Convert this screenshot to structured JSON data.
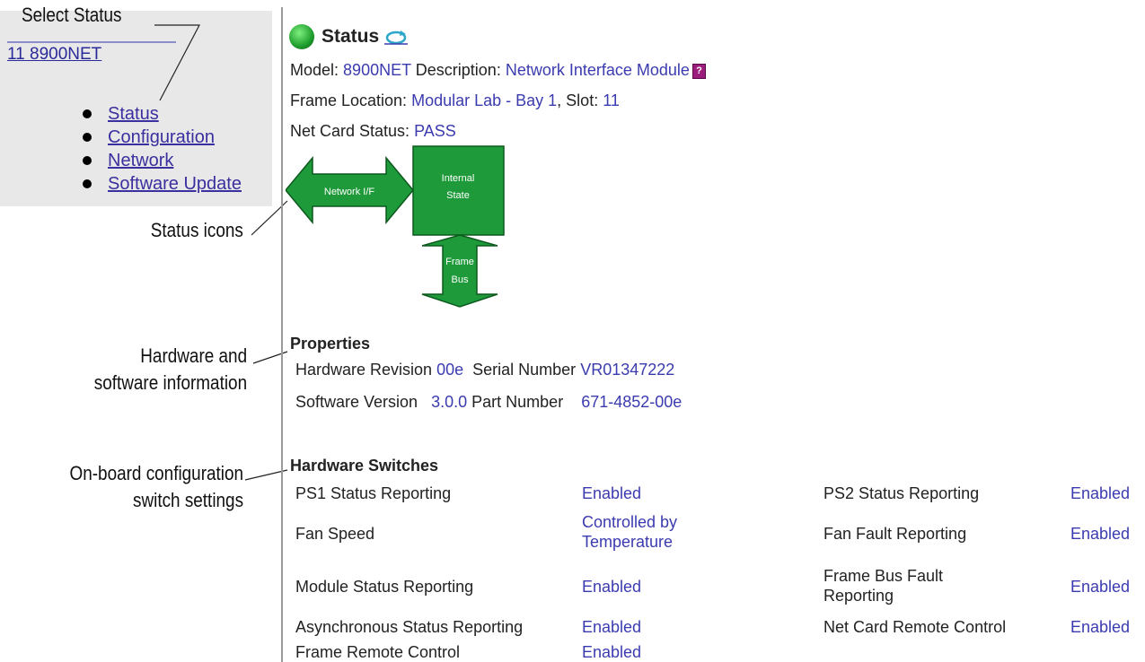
{
  "callouts": {
    "select_status": "Select Status",
    "status_icons": "Status icons",
    "hw_sw_line1": "Hardware and",
    "hw_sw_line2": "software information",
    "onboard_line1": "On-board configuration",
    "onboard_line2": "switch settings"
  },
  "nav": {
    "module_link": "11 8900NET",
    "items": [
      {
        "label": "Status"
      },
      {
        "label": "Configuration"
      },
      {
        "label": "Network"
      },
      {
        "label": "Software Update"
      }
    ]
  },
  "status": {
    "title": "Status",
    "model_label": "Model:",
    "model_value": "8900NET",
    "description_label": "Description:",
    "description_value": "Network Interface Module",
    "help_glyph": "?",
    "frame_location_label": "Frame Location:",
    "frame_location_value": "Modular Lab - Bay 1",
    "slot_label": ", Slot:",
    "slot_value": "11",
    "net_card_label": "Net Card Status:",
    "net_card_value": "PASS"
  },
  "diagram": {
    "network_if": "Network I/F",
    "internal_line1": "Internal",
    "internal_line2": "State",
    "frame_line1": "Frame",
    "frame_line2": "Bus",
    "fill_color": "#1f9a3a"
  },
  "properties": {
    "heading": "Properties",
    "hw_rev_label": "Hardware Revision",
    "hw_rev_value": "00e",
    "serial_label": "Serial Number",
    "serial_value": "VR01347222",
    "sw_ver_label": "Software Version",
    "sw_ver_value": "3.0.0",
    "part_label": "Part Number",
    "part_value": "671-4852-00e"
  },
  "switches": {
    "heading": "Hardware Switches",
    "rows": [
      {
        "l1": "PS1 Status Reporting",
        "v1": "Enabled",
        "l2": "PS2 Status Reporting",
        "v2": "Enabled"
      },
      {
        "l1": "Fan Speed",
        "v1a": "Controlled by",
        "v1b": "Temperature",
        "l2": "Fan Fault Reporting",
        "v2": "Enabled"
      },
      {
        "l1": "Module Status Reporting",
        "v1": "Enabled",
        "l2a": "Frame Bus Fault",
        "l2b": "Reporting",
        "v2": "Enabled"
      },
      {
        "l1": "Asynchronous Status Reporting",
        "v1": "Enabled",
        "l2": "Net Card Remote Control",
        "v2": "Enabled"
      },
      {
        "l1": "Frame Remote Control",
        "v1": "Enabled"
      }
    ]
  },
  "colors": {
    "link": "#3b3bb0",
    "left_pane_bg": "#e8e8e8",
    "status_green": "#1f9a3a"
  }
}
